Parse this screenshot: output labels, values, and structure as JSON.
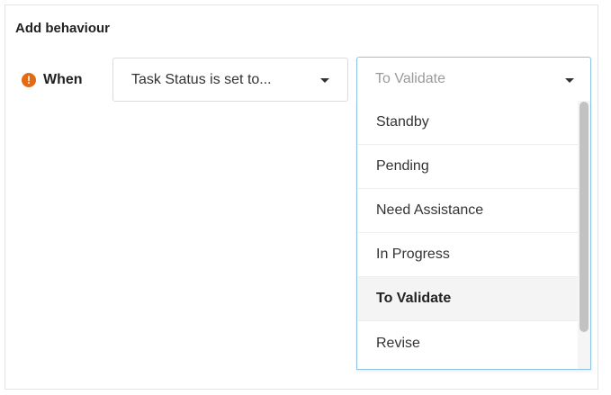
{
  "panel": {
    "title": "Add behaviour"
  },
  "condition": {
    "warning_icon": "!",
    "when_label": "When",
    "trigger_select": "Task Status is set to...",
    "value_select_placeholder": "To Validate"
  },
  "dropdown": {
    "options": [
      "Standby",
      "Pending",
      "Need Assistance",
      "In Progress",
      "To Validate",
      "Revise"
    ],
    "selected": "To Validate"
  },
  "colors": {
    "warning": "#e36b16",
    "focus_border": "#8fc3e6",
    "selected_bg": "#f4f4f4"
  }
}
